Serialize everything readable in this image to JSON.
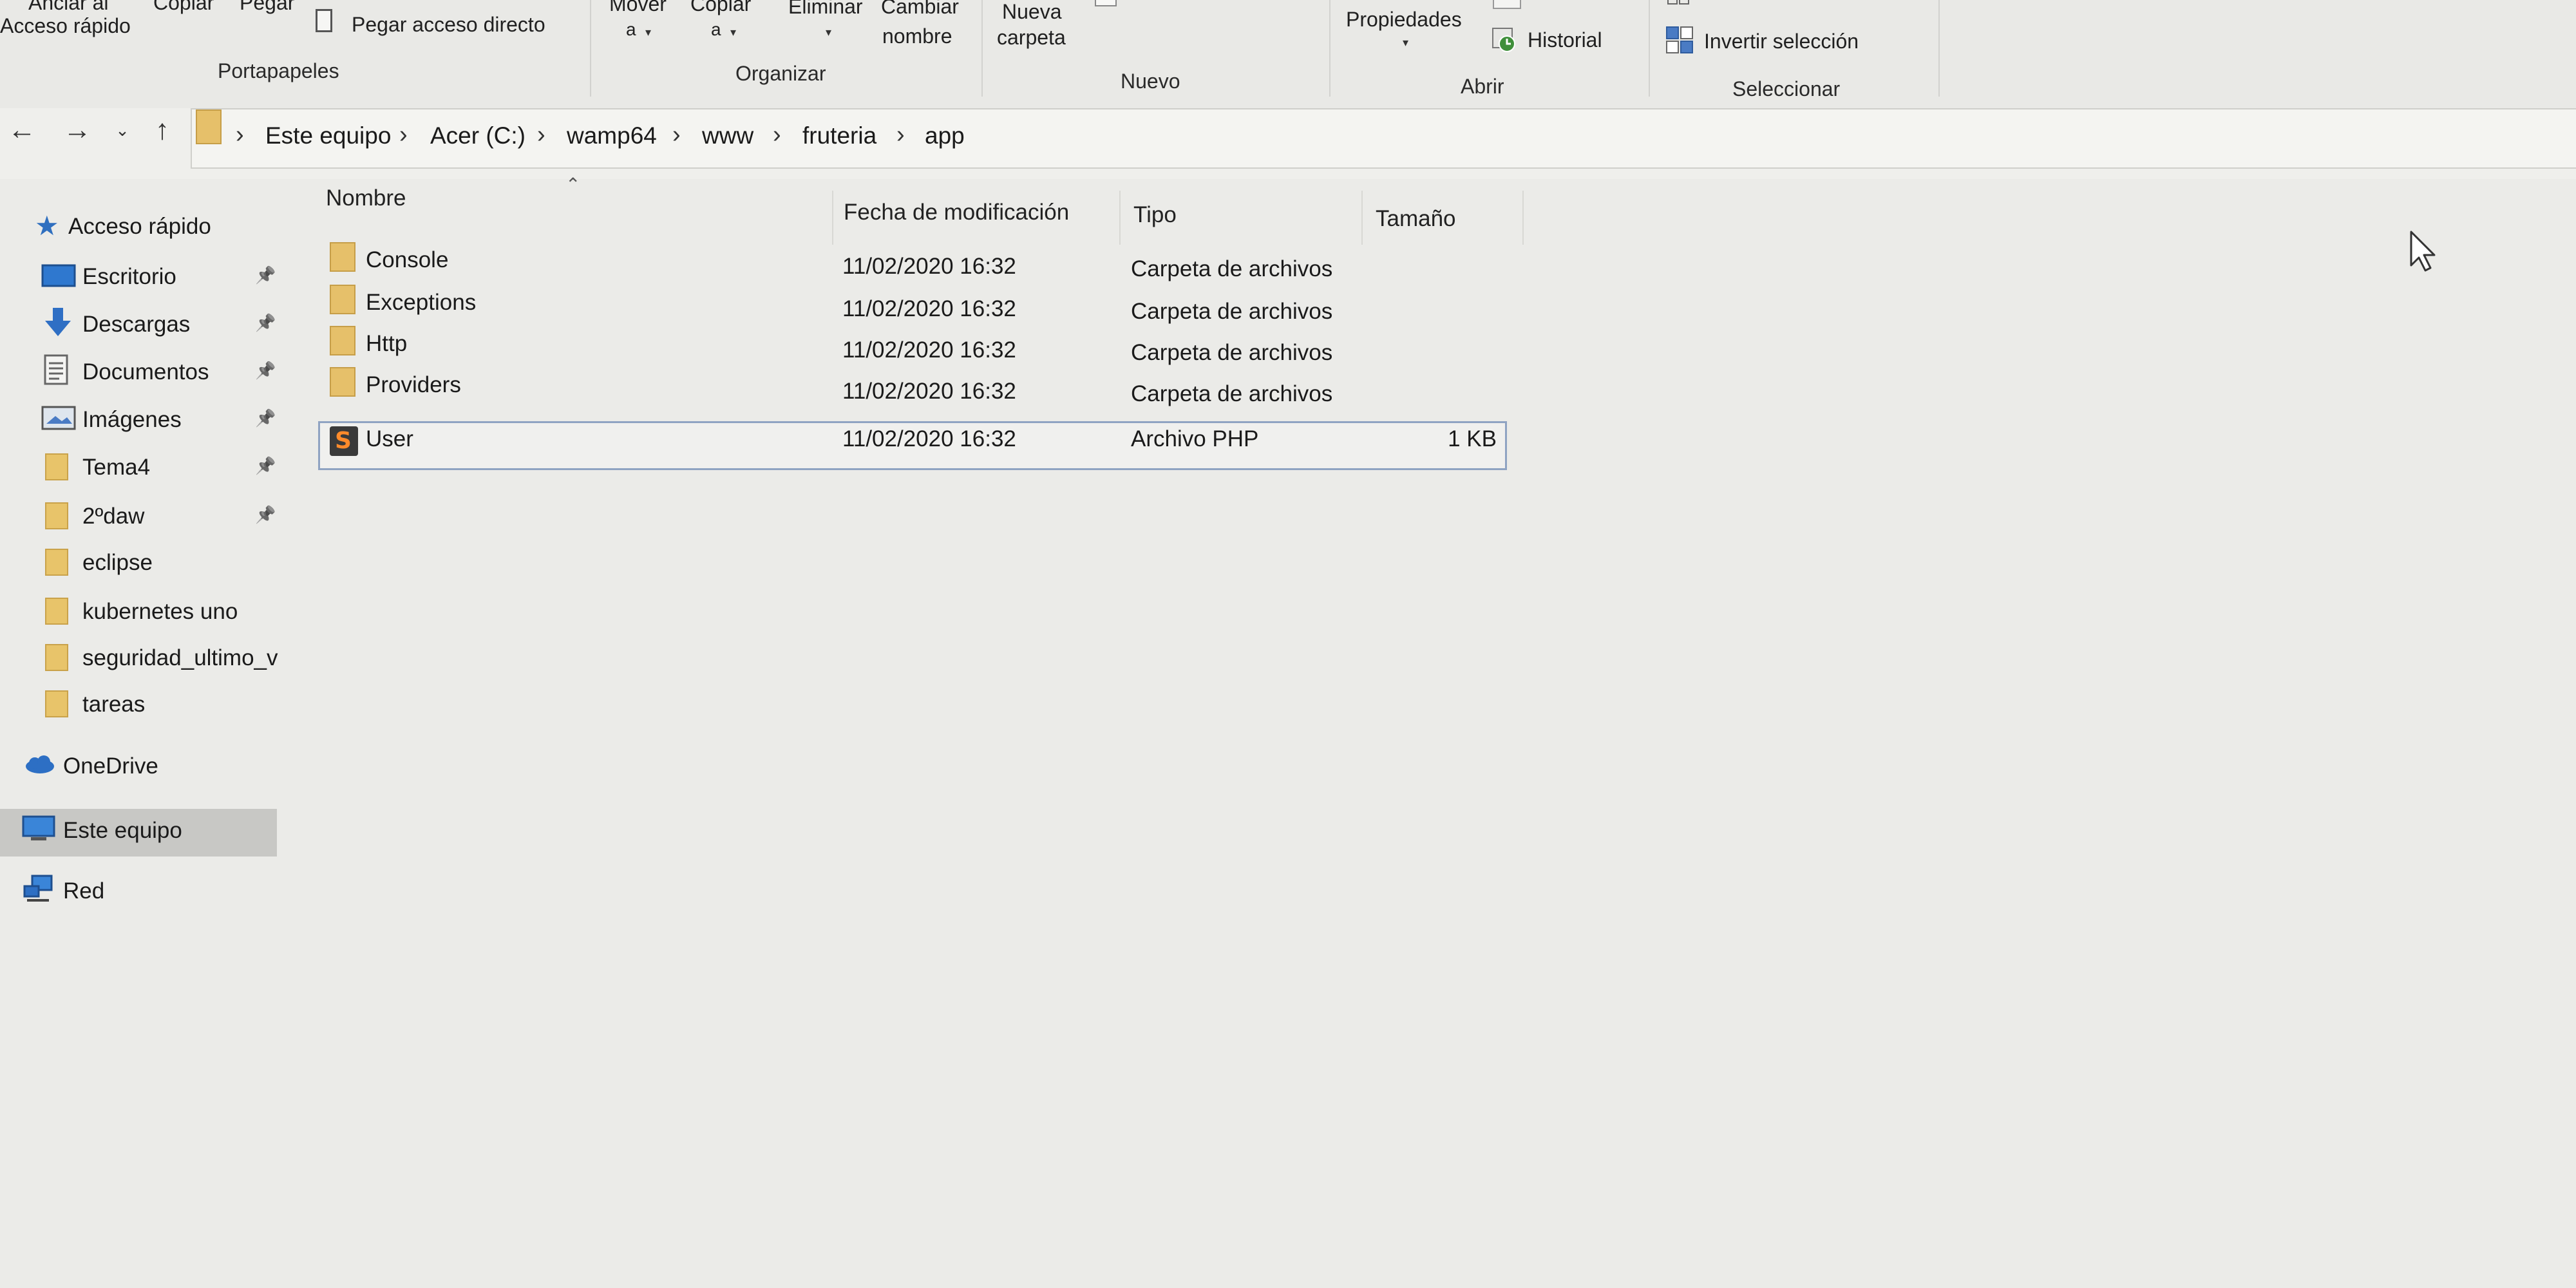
{
  "ribbon": {
    "clip": {
      "anclar_line1": "Anclar al",
      "anclar_line2": "Acceso rápido",
      "copiar": "Copiar",
      "pegar": "Pegar",
      "pegar_acceso_directo": "Pegar acceso directo",
      "group_label": "Portapapeles"
    },
    "organize": {
      "mover_line1": "Mover",
      "mover_line2": "a",
      "copiar_line1": "Copiar",
      "copiar_line2": "a",
      "eliminar": "Eliminar",
      "cambiar_line1": "Cambiar",
      "cambiar_line2": "nombre",
      "group_label": "Organizar"
    },
    "new": {
      "nueva_line1": "Nueva",
      "nueva_line2": "carpeta",
      "group_label": "Nuevo"
    },
    "open": {
      "propiedades": "Propiedades",
      "historial": "Historial",
      "group_label": "Abrir"
    },
    "select": {
      "invertir": "Invertir selección",
      "group_label": "Seleccionar"
    }
  },
  "address": {
    "crumbs": [
      "Este equipo",
      "Acer (C:)",
      "wamp64",
      "www",
      "fruteria",
      "app"
    ]
  },
  "sidebar": {
    "quick_access": "Acceso rápido",
    "items": [
      {
        "label": "Escritorio",
        "icon": "desktop-icon",
        "pinned": true
      },
      {
        "label": "Descargas",
        "icon": "download-icon",
        "pinned": true
      },
      {
        "label": "Documentos",
        "icon": "document-icon",
        "pinned": true
      },
      {
        "label": "Imágenes",
        "icon": "pictures-icon",
        "pinned": true
      },
      {
        "label": "Tema4",
        "icon": "folder-icon",
        "pinned": true
      },
      {
        "label": "2ºdaw",
        "icon": "folder-icon",
        "pinned": true
      },
      {
        "label": "eclipse",
        "icon": "folder-icon",
        "pinned": false
      },
      {
        "label": "kubernetes uno",
        "icon": "folder-icon",
        "pinned": false
      },
      {
        "label": "seguridad_ultimo_v",
        "icon": "folder-icon",
        "pinned": false
      },
      {
        "label": "tareas",
        "icon": "folder-icon",
        "pinned": false
      }
    ],
    "onedrive": "OneDrive",
    "this_pc": "Este equipo",
    "network": "Red"
  },
  "file_list": {
    "columns": {
      "name": "Nombre",
      "modified": "Fecha de modificación",
      "type": "Tipo",
      "size": "Tamaño"
    },
    "rows": [
      {
        "name": "Console",
        "modified": "11/02/2020 16:32",
        "type": "Carpeta de archivos",
        "size": "",
        "icon": "folder-icon"
      },
      {
        "name": "Exceptions",
        "modified": "11/02/2020 16:32",
        "type": "Carpeta de archivos",
        "size": "",
        "icon": "folder-icon"
      },
      {
        "name": "Http",
        "modified": "11/02/2020 16:32",
        "type": "Carpeta de archivos",
        "size": "",
        "icon": "folder-icon"
      },
      {
        "name": "Providers",
        "modified": "11/02/2020 16:32",
        "type": "Carpeta de archivos",
        "size": "",
        "icon": "folder-icon"
      },
      {
        "name": "User",
        "modified": "11/02/2020 16:32",
        "type": "Archivo PHP",
        "size": "1 KB",
        "icon": "sublime-file-icon"
      }
    ]
  }
}
